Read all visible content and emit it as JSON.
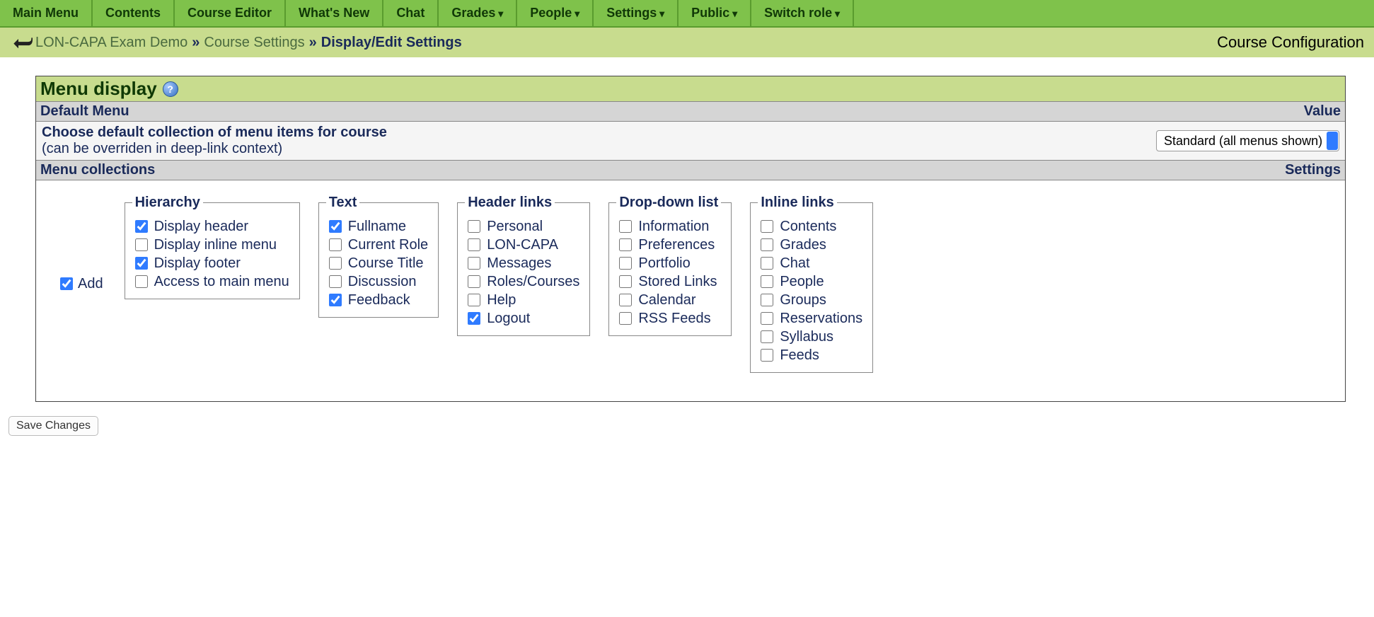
{
  "nav": {
    "items": [
      {
        "label": "Main Menu",
        "dropdown": false
      },
      {
        "label": "Contents",
        "dropdown": false
      },
      {
        "label": "Course Editor",
        "dropdown": false
      },
      {
        "label": "What's New",
        "dropdown": false
      },
      {
        "label": "Chat",
        "dropdown": false
      },
      {
        "label": "Grades",
        "dropdown": true
      },
      {
        "label": "People",
        "dropdown": true
      },
      {
        "label": "Settings",
        "dropdown": true
      },
      {
        "label": "Public",
        "dropdown": true
      },
      {
        "label": "Switch role",
        "dropdown": true
      }
    ]
  },
  "breadcrumb": {
    "items": [
      {
        "label": "LON-CAPA Exam Demo"
      },
      {
        "label": "Course Settings"
      }
    ],
    "current": "Display/Edit Settings",
    "page_title": "Course Configuration"
  },
  "panel": {
    "title": "Menu display",
    "default_menu_header_left": "Default Menu",
    "default_menu_header_right": "Value",
    "default_menu_desc": "Choose default collection of menu items for course",
    "default_menu_sub": "(can be overriden in deep-link context)",
    "default_menu_select_value": "Standard (all menus shown)",
    "collections_header_left": "Menu collections",
    "collections_header_right": "Settings",
    "add_label": "Add",
    "add_checked": true,
    "groups": [
      {
        "legend": "Hierarchy",
        "items": [
          {
            "label": "Display header",
            "checked": true
          },
          {
            "label": "Display inline menu",
            "checked": false
          },
          {
            "label": "Display footer",
            "checked": true
          },
          {
            "label": "Access to main menu",
            "checked": false
          }
        ]
      },
      {
        "legend": "Text",
        "items": [
          {
            "label": "Fullname",
            "checked": true
          },
          {
            "label": "Current Role",
            "checked": false
          },
          {
            "label": "Course Title",
            "checked": false
          },
          {
            "label": "Discussion",
            "checked": false
          },
          {
            "label": "Feedback",
            "checked": true
          }
        ]
      },
      {
        "legend": "Header links",
        "items": [
          {
            "label": "Personal",
            "checked": false
          },
          {
            "label": "LON-CAPA",
            "checked": false
          },
          {
            "label": "Messages",
            "checked": false
          },
          {
            "label": "Roles/Courses",
            "checked": false
          },
          {
            "label": "Help",
            "checked": false
          },
          {
            "label": "Logout",
            "checked": true
          }
        ]
      },
      {
        "legend": "Drop-down list",
        "items": [
          {
            "label": "Information",
            "checked": false
          },
          {
            "label": "Preferences",
            "checked": false
          },
          {
            "label": "Portfolio",
            "checked": false
          },
          {
            "label": "Stored Links",
            "checked": false
          },
          {
            "label": "Calendar",
            "checked": false
          },
          {
            "label": "RSS Feeds",
            "checked": false
          }
        ]
      },
      {
        "legend": "Inline links",
        "items": [
          {
            "label": "Contents",
            "checked": false
          },
          {
            "label": "Grades",
            "checked": false
          },
          {
            "label": "Chat",
            "checked": false
          },
          {
            "label": "People",
            "checked": false
          },
          {
            "label": "Groups",
            "checked": false
          },
          {
            "label": "Reservations",
            "checked": false
          },
          {
            "label": "Syllabus",
            "checked": false
          },
          {
            "label": "Feeds",
            "checked": false
          }
        ]
      }
    ]
  },
  "save_button_label": "Save Changes"
}
